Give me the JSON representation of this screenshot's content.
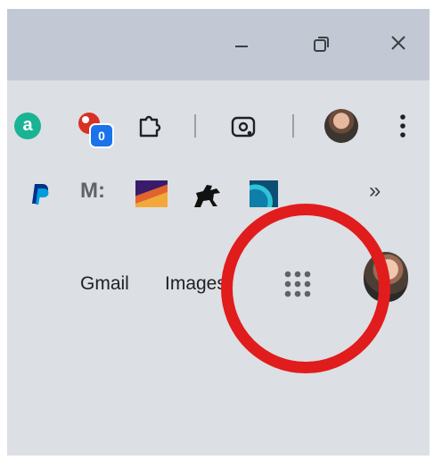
{
  "window_controls": {
    "minimize_icon": "minimize-icon",
    "maximize_icon": "restore-icon",
    "close_icon": "close-icon"
  },
  "toolbar": {
    "extension_a_letter": "a",
    "notification_badge": "0",
    "icons": [
      "extension-a-icon",
      "extension-red-icon",
      "extensions-puzzle-icon",
      "google-lens-icon",
      "profile-avatar",
      "menu-kebab-icon"
    ]
  },
  "bookmarks": {
    "items": [
      "paypal-icon",
      "m-bookmark",
      "gradient-bookmark",
      "horse-bookmark",
      "teal-bookmark"
    ],
    "m_label": "M:",
    "overflow_label": "»"
  },
  "page": {
    "gmail_label": "Gmail",
    "images_label": "Images",
    "apps_icon": "apps-grid-icon",
    "avatar": "user-avatar"
  },
  "colors": {
    "titlebar": "#c3c9d4",
    "frame": "#dcdfe3",
    "highlight_circle": "#e11c1c",
    "badge": "#1a73e8"
  }
}
